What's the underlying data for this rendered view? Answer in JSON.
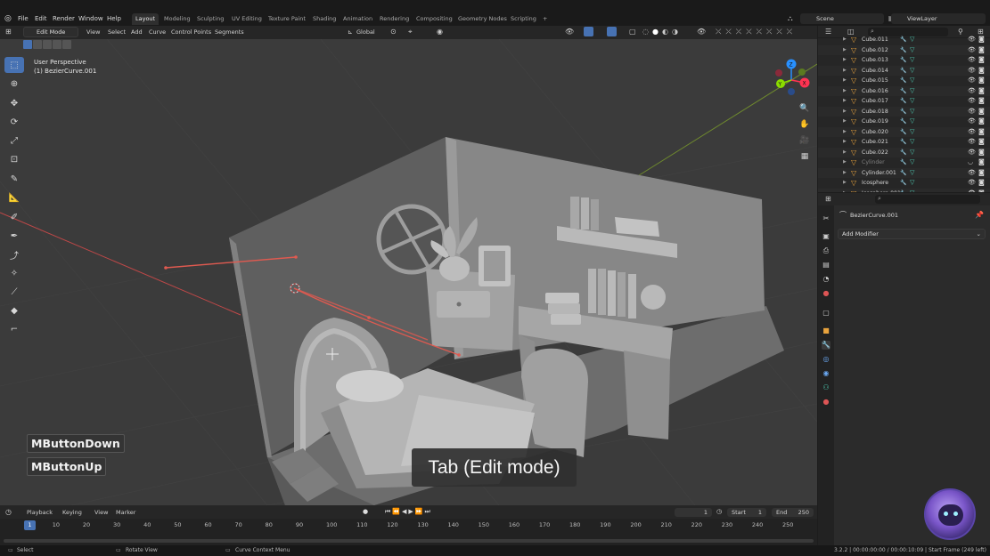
{
  "menu": {
    "items": [
      "File",
      "Edit",
      "Render",
      "Window",
      "Help"
    ]
  },
  "workspaces": {
    "tabs": [
      "Layout",
      "Modeling",
      "Sculpting",
      "UV Editing",
      "Texture Paint",
      "Shading",
      "Animation",
      "Rendering",
      "Compositing",
      "Geometry Nodes",
      "Scripting"
    ],
    "active": "Layout",
    "add": "+"
  },
  "scene": {
    "name": "Scene",
    "view_layer": "ViewLayer"
  },
  "viewport_header": {
    "mode": "Edit Mode",
    "menus": [
      "View",
      "Select",
      "Add",
      "Curve",
      "Control Points",
      "Segments"
    ],
    "orientation": "Global"
  },
  "viewport": {
    "perspective": "User Perspective",
    "object": "(1) BezierCurve.001",
    "gizmo_axes": {
      "x": "X",
      "y": "Y",
      "z": "Z"
    }
  },
  "overlay": {
    "key1": "MButtonDown",
    "key2": "MButtonUp",
    "caption": "Tab (Edit mode)"
  },
  "timeline": {
    "menus": [
      "Playback",
      "Keying",
      "View",
      "Marker"
    ],
    "current_frame": "1",
    "start_label": "Start",
    "start": "1",
    "end_label": "End",
    "end": "250",
    "ticks": [
      "10",
      "20",
      "30",
      "40",
      "50",
      "60",
      "70",
      "80",
      "90",
      "100",
      "110",
      "120",
      "130",
      "140",
      "150",
      "160",
      "170",
      "180",
      "190",
      "200",
      "210",
      "220",
      "230",
      "240",
      "250"
    ],
    "playhead": "1"
  },
  "outliner": {
    "rows": [
      {
        "name": "Cube.011",
        "dim": false
      },
      {
        "name": "Cube.012",
        "dim": false
      },
      {
        "name": "Cube.013",
        "dim": false
      },
      {
        "name": "Cube.014",
        "dim": false
      },
      {
        "name": "Cube.015",
        "dim": false
      },
      {
        "name": "Cube.016",
        "dim": false
      },
      {
        "name": "Cube.017",
        "dim": false
      },
      {
        "name": "Cube.018",
        "dim": false
      },
      {
        "name": "Cube.019",
        "dim": false
      },
      {
        "name": "Cube.020",
        "dim": false
      },
      {
        "name": "Cube.021",
        "dim": false
      },
      {
        "name": "Cube.022",
        "dim": false
      },
      {
        "name": "Cylinder",
        "dim": true
      },
      {
        "name": "Cylinder.001",
        "dim": false
      },
      {
        "name": "Icosphere",
        "dim": false
      },
      {
        "name": "Icosphere.001",
        "dim": false
      }
    ]
  },
  "properties": {
    "object": "BezierCurve.001",
    "add_modifier": "Add Modifier"
  },
  "statusbar": {
    "left": "Select",
    "middle": "Rotate View",
    "right_hint": "Curve Context Menu",
    "info": "3.2.2 | 00:00:00:00 / 00:00:10:09 | Start Frame (249 left)"
  },
  "colors": {
    "accent": "#4772b3",
    "axis_x": "#ff3352",
    "axis_y": "#8bdc00",
    "axis_z": "#2890ff",
    "curve": "#e0504a"
  }
}
